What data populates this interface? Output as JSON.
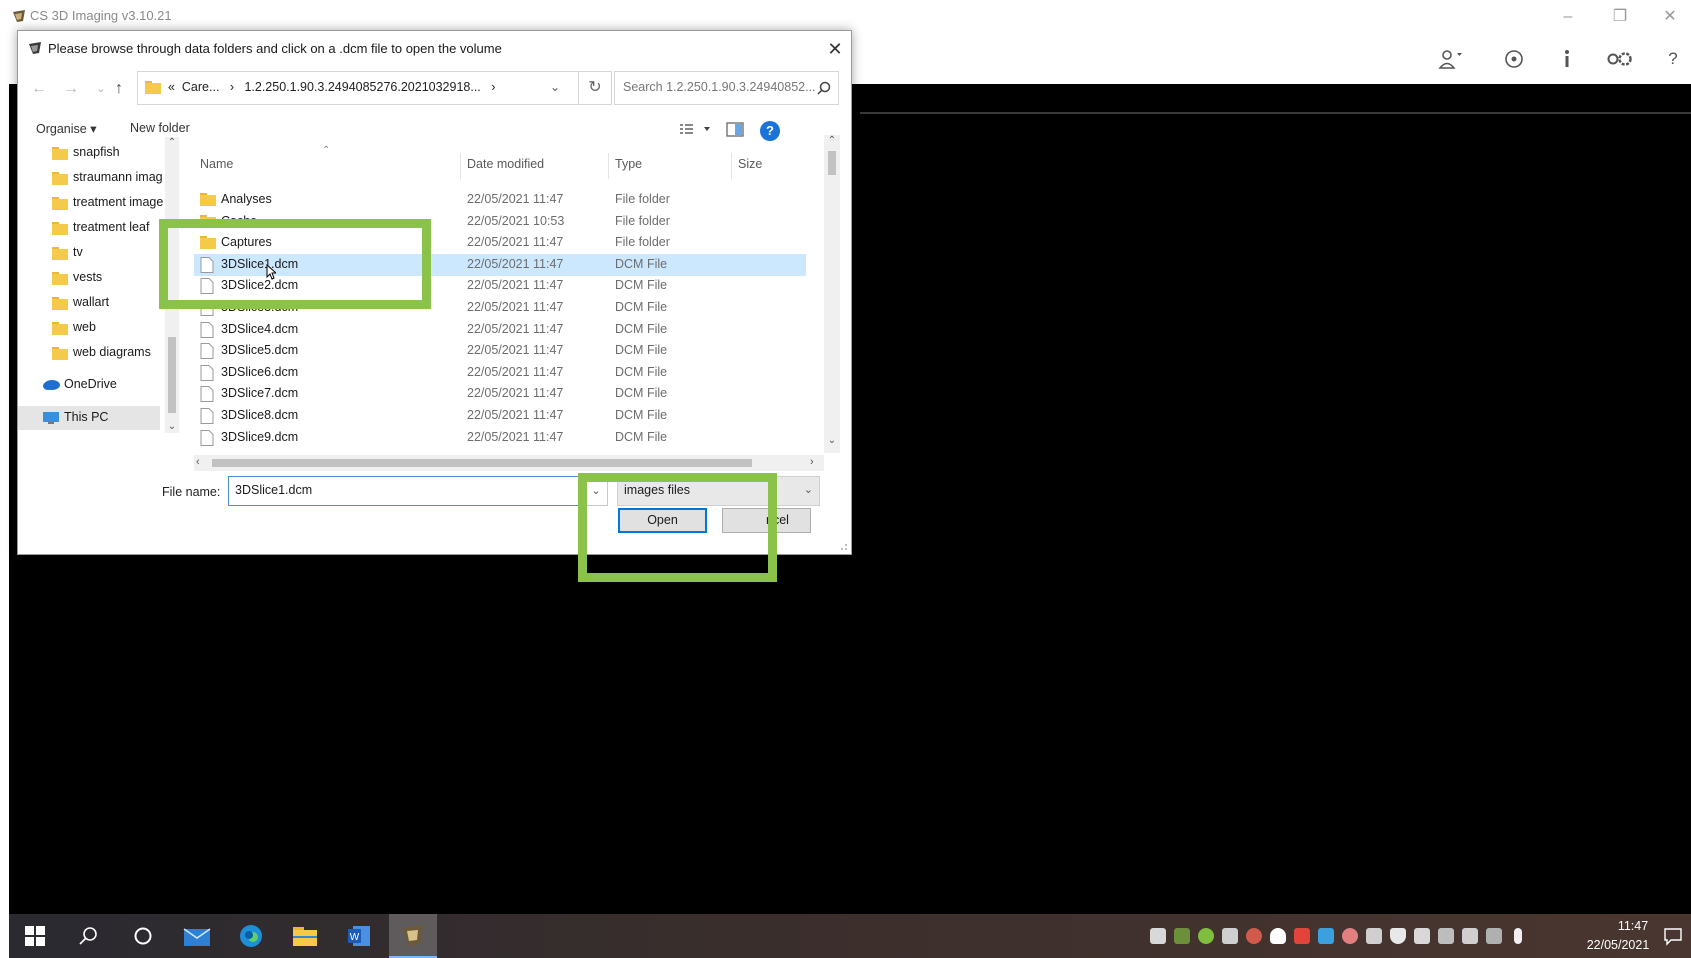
{
  "app": {
    "title": "CS 3D Imaging v3.10.21",
    "window_controls": {
      "minimize": "–",
      "restore": "❐",
      "close": "✕"
    },
    "tools": [
      "user-dropdown-icon",
      "target-icon",
      "info-icon",
      "settings-icon",
      "help-icon"
    ],
    "help_label": "?"
  },
  "dialog": {
    "title": "Please browse through data folders and click on a .dcm file to open the volume",
    "close_label": "✕",
    "address": {
      "prefix": "«",
      "crumb1": "Care...",
      "sep": "›",
      "crumb2": "1.2.250.1.90.3.2494085276.2021032918...",
      "sep2": "›"
    },
    "search_placeholder": "Search 1.2.250.1.90.3.24940852...",
    "toolbar": {
      "organise": "Organise ▾",
      "new_folder": "New folder",
      "help": "?"
    },
    "nav_items": [
      {
        "label": "snapfish",
        "icon": "folder-icon"
      },
      {
        "label": "straumann imag",
        "icon": "folder-icon"
      },
      {
        "label": "treatment image",
        "icon": "folder-icon"
      },
      {
        "label": "treatment leaf",
        "icon": "folder-icon"
      },
      {
        "label": "tv",
        "icon": "folder-icon"
      },
      {
        "label": "vests",
        "icon": "folder-icon"
      },
      {
        "label": "wallart",
        "icon": "folder-icon"
      },
      {
        "label": "web",
        "icon": "folder-icon"
      },
      {
        "label": "web diagrams",
        "icon": "folder-icon"
      },
      {
        "label": "OneDrive",
        "icon": "onedrive-icon"
      },
      {
        "label": "This PC",
        "icon": "computer-icon"
      }
    ],
    "columns": {
      "name": "Name",
      "date": "Date modified",
      "type": "Type",
      "size": "Size"
    },
    "files": [
      {
        "name": "Analyses",
        "date": "22/05/2021 11:47",
        "type": "File folder",
        "kind": "folder"
      },
      {
        "name": "Cache",
        "date": "22/05/2021 10:53",
        "type": "File folder",
        "kind": "folder"
      },
      {
        "name": "Captures",
        "date": "22/05/2021 11:47",
        "type": "File folder",
        "kind": "folder"
      },
      {
        "name": "3DSlice1.dcm",
        "date": "22/05/2021 11:47",
        "type": "DCM File",
        "kind": "file",
        "selected": true
      },
      {
        "name": "3DSlice2.dcm",
        "date": "22/05/2021 11:47",
        "type": "DCM File",
        "kind": "file"
      },
      {
        "name": "3DSlice3.dcm",
        "date": "22/05/2021 11:47",
        "type": "DCM File",
        "kind": "file"
      },
      {
        "name": "3DSlice4.dcm",
        "date": "22/05/2021 11:47",
        "type": "DCM File",
        "kind": "file"
      },
      {
        "name": "3DSlice5.dcm",
        "date": "22/05/2021 11:47",
        "type": "DCM File",
        "kind": "file"
      },
      {
        "name": "3DSlice6.dcm",
        "date": "22/05/2021 11:47",
        "type": "DCM File",
        "kind": "file"
      },
      {
        "name": "3DSlice7.dcm",
        "date": "22/05/2021 11:47",
        "type": "DCM File",
        "kind": "file"
      },
      {
        "name": "3DSlice8.dcm",
        "date": "22/05/2021 11:47",
        "type": "DCM File",
        "kind": "file"
      },
      {
        "name": "3DSlice9.dcm",
        "date": "22/05/2021 11:47",
        "type": "DCM File",
        "kind": "file"
      }
    ],
    "file_name_label": "File name:",
    "file_name_value": "3DSlice1.dcm",
    "file_type_value": "images files",
    "open_label": "Open",
    "cancel_label": "ncel"
  },
  "taskbar": {
    "apps": [
      "windows-start-icon",
      "search-icon",
      "cortana-icon",
      "mail-icon",
      "edge-icon",
      "file-explorer-icon",
      "word-icon",
      "cs-imaging-app-icon"
    ],
    "time": "11:47",
    "date": "22/05/2021"
  },
  "colors": {
    "highlight": "#8bc34a",
    "selection": "#cce8ff",
    "accent": "#0078d7",
    "canvas": "#000000"
  }
}
